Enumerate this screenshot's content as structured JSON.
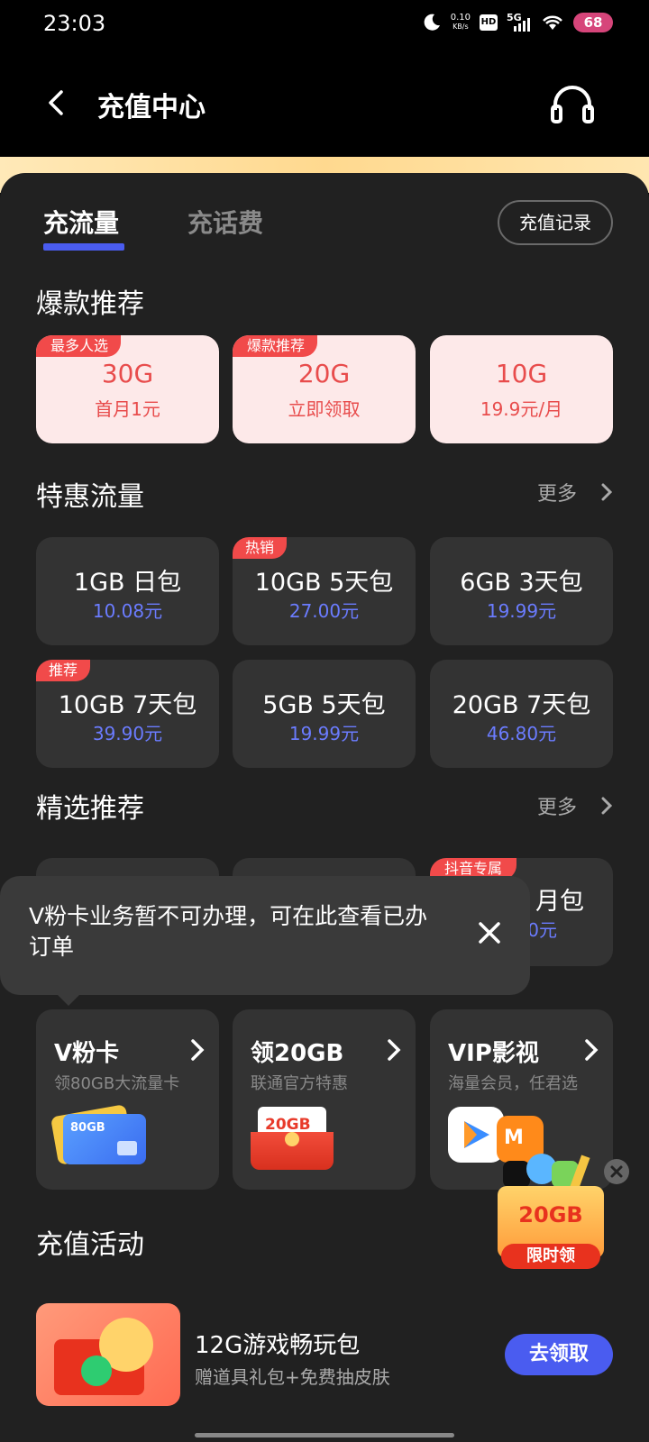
{
  "status_bar": {
    "time": "23:03",
    "net_speed": "0.10",
    "net_unit": "KB/s",
    "hd": "HD",
    "signal": "5G",
    "battery": "68",
    "icons": [
      "moon-icon",
      "hd-icon",
      "signal-icon",
      "wifi-icon",
      "battery-icon"
    ]
  },
  "header": {
    "title": "充值中心",
    "back_icon": "chevron-left-icon",
    "service_icon": "headset-icon"
  },
  "tabs": [
    {
      "label": "充流量",
      "active": true
    },
    {
      "label": "充话费",
      "active": false
    }
  ],
  "record_button": "充值记录",
  "hot": {
    "title": "爆款推荐",
    "cards": [
      {
        "badge": "最多人选",
        "amount": "30G",
        "price": "首月1元"
      },
      {
        "badge": "爆款推荐",
        "amount": "20G",
        "price": "立即领取"
      },
      {
        "badge": "",
        "amount": "10G",
        "price": "19.9元/月"
      }
    ]
  },
  "discount": {
    "title": "特惠流量",
    "more": "更多",
    "cards": [
      {
        "badge": "",
        "name": "1GB 日包",
        "price": "10.08元"
      },
      {
        "badge": "热销",
        "name": "10GB 5天包",
        "price": "27.00元"
      },
      {
        "badge": "",
        "name": "6GB 3天包",
        "price": "19.99元"
      },
      {
        "badge": "推荐",
        "name": "10GB 7天包",
        "price": "39.90元"
      },
      {
        "badge": "",
        "name": "5GB 5天包",
        "price": "19.99元"
      },
      {
        "badge": "",
        "name": "20GB 7天包",
        "price": "46.80元"
      }
    ]
  },
  "selected": {
    "title": "精选推荐",
    "more": "更多",
    "partial_card": {
      "badge": "抖音专属",
      "name": "月包",
      "price": "0元"
    }
  },
  "tooltip": {
    "text": "V粉卡业务暂不可办理，可在此查看已办订单"
  },
  "features": [
    {
      "title": "V粉卡",
      "sub": "领80GB大流量卡",
      "img_label": "80GB"
    },
    {
      "title": "领20GB",
      "sub": "联通官方特惠",
      "img_label": "20GB"
    },
    {
      "title": "VIP影视",
      "sub": "海量会员，任君选",
      "img_label": ""
    }
  ],
  "promo": {
    "amount": "20GB",
    "label": "限时领"
  },
  "activity": {
    "title": "充值活动",
    "item_title": "12G游戏畅玩包",
    "item_sub": "赠道具礼包+免费抽皮肤",
    "button": "去领取"
  },
  "colors": {
    "accent": "#4a5cf0",
    "badge_red": "#f14a4a",
    "price_blue": "#6b7cff",
    "hot_bg": "#fde9e9",
    "panel_bg": "#212121",
    "card_bg": "#333333"
  }
}
